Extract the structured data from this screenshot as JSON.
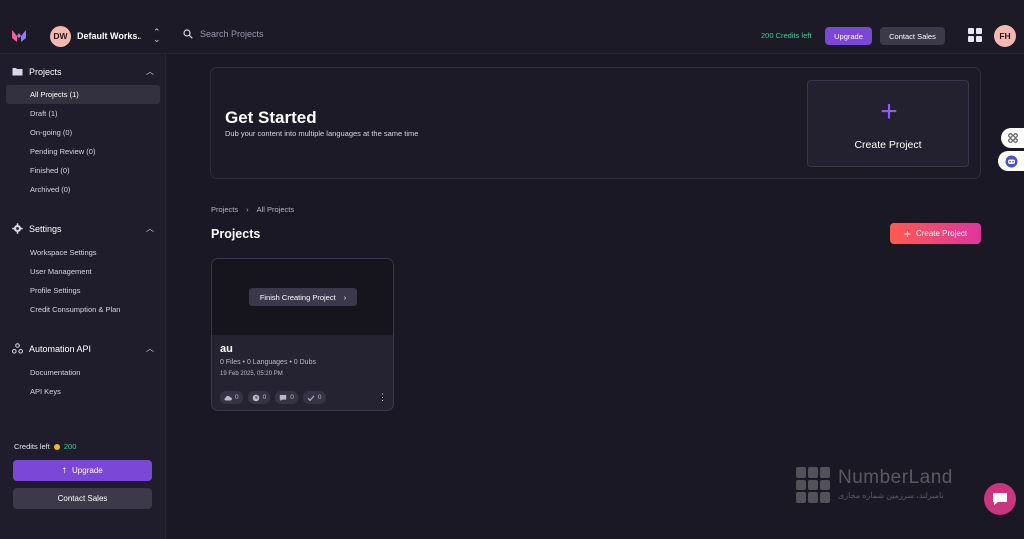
{
  "topbar": {
    "workspace_initials": "DW",
    "workspace_name": "Default Works...",
    "search_placeholder": "Search Projects",
    "credits_text": "200 Credits left",
    "upgrade_label": "Upgrade",
    "contact_sales_label": "Contact Sales",
    "user_initials": "FH"
  },
  "sidebar": {
    "projects_heading": "Projects",
    "project_items": [
      {
        "label": "All Projects (1)",
        "active": true
      },
      {
        "label": "Draft (1)"
      },
      {
        "label": "On-going (0)"
      },
      {
        "label": "Pending Review (0)"
      },
      {
        "label": "Finished (0)"
      },
      {
        "label": "Archived (0)"
      }
    ],
    "settings_heading": "Settings",
    "settings_items": [
      {
        "label": "Workspace Settings"
      },
      {
        "label": "User Management"
      },
      {
        "label": "Profile Settings"
      },
      {
        "label": "Credit Consumption & Plan"
      }
    ],
    "api_heading": "Automation API",
    "api_items": [
      {
        "label": "Documentation"
      },
      {
        "label": "API Keys"
      }
    ],
    "credits_label": "Credits left",
    "credits_value": "200",
    "upgrade_label": "Upgrade",
    "contact_sales_label": "Contact Sales"
  },
  "get_started": {
    "title": "Get Started",
    "subtitle": "Dub your content into multiple languages at the same time",
    "create_label": "Create Project"
  },
  "breadcrumb": {
    "root": "Projects",
    "current": "All Projects"
  },
  "projects": {
    "title": "Projects",
    "create_button": "Create Project",
    "card": {
      "finish_label": "Finish Creating Project",
      "name": "au",
      "meta": "0 Files • 0 Languages • 0 Dubs",
      "date": "19 Feb 2025, 05:20 PM",
      "stats": [
        "0",
        "0",
        "0",
        "0"
      ]
    }
  },
  "watermark": {
    "brand": "NumberLand",
    "tagline": "نامبرلند، سرزمین شماره مجازی"
  },
  "colors": {
    "accent_purple": "#7b47d6",
    "credits_green": "#3fcf8e",
    "gradient_start": "#ff5a4e",
    "gradient_end": "#e0359e"
  }
}
